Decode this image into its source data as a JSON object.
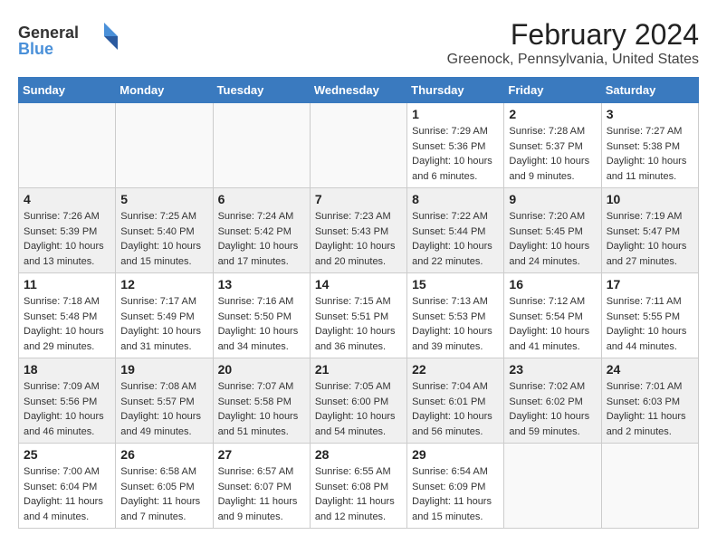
{
  "logo": {
    "line1": "General",
    "line2": "Blue"
  },
  "title": "February 2024",
  "subtitle": "Greenock, Pennsylvania, United States",
  "weekdays": [
    "Sunday",
    "Monday",
    "Tuesday",
    "Wednesday",
    "Thursday",
    "Friday",
    "Saturday"
  ],
  "weeks": [
    [
      {
        "day": "",
        "info": ""
      },
      {
        "day": "",
        "info": ""
      },
      {
        "day": "",
        "info": ""
      },
      {
        "day": "",
        "info": ""
      },
      {
        "day": "1",
        "info": "Sunrise: 7:29 AM\nSunset: 5:36 PM\nDaylight: 10 hours and 6 minutes."
      },
      {
        "day": "2",
        "info": "Sunrise: 7:28 AM\nSunset: 5:37 PM\nDaylight: 10 hours and 9 minutes."
      },
      {
        "day": "3",
        "info": "Sunrise: 7:27 AM\nSunset: 5:38 PM\nDaylight: 10 hours and 11 minutes."
      }
    ],
    [
      {
        "day": "4",
        "info": "Sunrise: 7:26 AM\nSunset: 5:39 PM\nDaylight: 10 hours and 13 minutes."
      },
      {
        "day": "5",
        "info": "Sunrise: 7:25 AM\nSunset: 5:40 PM\nDaylight: 10 hours and 15 minutes."
      },
      {
        "day": "6",
        "info": "Sunrise: 7:24 AM\nSunset: 5:42 PM\nDaylight: 10 hours and 17 minutes."
      },
      {
        "day": "7",
        "info": "Sunrise: 7:23 AM\nSunset: 5:43 PM\nDaylight: 10 hours and 20 minutes."
      },
      {
        "day": "8",
        "info": "Sunrise: 7:22 AM\nSunset: 5:44 PM\nDaylight: 10 hours and 22 minutes."
      },
      {
        "day": "9",
        "info": "Sunrise: 7:20 AM\nSunset: 5:45 PM\nDaylight: 10 hours and 24 minutes."
      },
      {
        "day": "10",
        "info": "Sunrise: 7:19 AM\nSunset: 5:47 PM\nDaylight: 10 hours and 27 minutes."
      }
    ],
    [
      {
        "day": "11",
        "info": "Sunrise: 7:18 AM\nSunset: 5:48 PM\nDaylight: 10 hours and 29 minutes."
      },
      {
        "day": "12",
        "info": "Sunrise: 7:17 AM\nSunset: 5:49 PM\nDaylight: 10 hours and 31 minutes."
      },
      {
        "day": "13",
        "info": "Sunrise: 7:16 AM\nSunset: 5:50 PM\nDaylight: 10 hours and 34 minutes."
      },
      {
        "day": "14",
        "info": "Sunrise: 7:15 AM\nSunset: 5:51 PM\nDaylight: 10 hours and 36 minutes."
      },
      {
        "day": "15",
        "info": "Sunrise: 7:13 AM\nSunset: 5:53 PM\nDaylight: 10 hours and 39 minutes."
      },
      {
        "day": "16",
        "info": "Sunrise: 7:12 AM\nSunset: 5:54 PM\nDaylight: 10 hours and 41 minutes."
      },
      {
        "day": "17",
        "info": "Sunrise: 7:11 AM\nSunset: 5:55 PM\nDaylight: 10 hours and 44 minutes."
      }
    ],
    [
      {
        "day": "18",
        "info": "Sunrise: 7:09 AM\nSunset: 5:56 PM\nDaylight: 10 hours and 46 minutes."
      },
      {
        "day": "19",
        "info": "Sunrise: 7:08 AM\nSunset: 5:57 PM\nDaylight: 10 hours and 49 minutes."
      },
      {
        "day": "20",
        "info": "Sunrise: 7:07 AM\nSunset: 5:58 PM\nDaylight: 10 hours and 51 minutes."
      },
      {
        "day": "21",
        "info": "Sunrise: 7:05 AM\nSunset: 6:00 PM\nDaylight: 10 hours and 54 minutes."
      },
      {
        "day": "22",
        "info": "Sunrise: 7:04 AM\nSunset: 6:01 PM\nDaylight: 10 hours and 56 minutes."
      },
      {
        "day": "23",
        "info": "Sunrise: 7:02 AM\nSunset: 6:02 PM\nDaylight: 10 hours and 59 minutes."
      },
      {
        "day": "24",
        "info": "Sunrise: 7:01 AM\nSunset: 6:03 PM\nDaylight: 11 hours and 2 minutes."
      }
    ],
    [
      {
        "day": "25",
        "info": "Sunrise: 7:00 AM\nSunset: 6:04 PM\nDaylight: 11 hours and 4 minutes."
      },
      {
        "day": "26",
        "info": "Sunrise: 6:58 AM\nSunset: 6:05 PM\nDaylight: 11 hours and 7 minutes."
      },
      {
        "day": "27",
        "info": "Sunrise: 6:57 AM\nSunset: 6:07 PM\nDaylight: 11 hours and 9 minutes."
      },
      {
        "day": "28",
        "info": "Sunrise: 6:55 AM\nSunset: 6:08 PM\nDaylight: 11 hours and 12 minutes."
      },
      {
        "day": "29",
        "info": "Sunrise: 6:54 AM\nSunset: 6:09 PM\nDaylight: 11 hours and 15 minutes."
      },
      {
        "day": "",
        "info": ""
      },
      {
        "day": "",
        "info": ""
      }
    ]
  ]
}
